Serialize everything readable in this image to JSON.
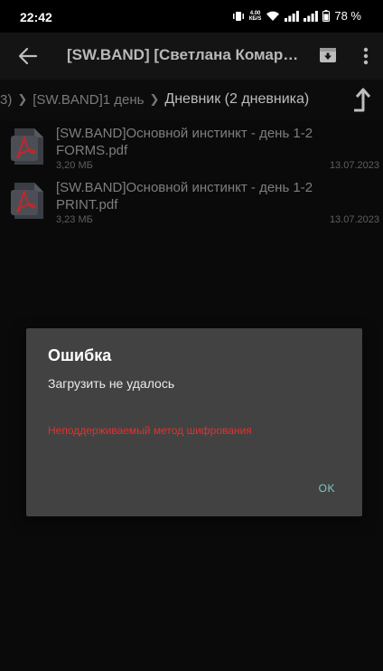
{
  "status_bar": {
    "time": "22:42",
    "net_speed_value": "4.00",
    "net_speed_unit": "КБ/S",
    "battery": "78 %"
  },
  "app_bar": {
    "title": "[SW.BAND] [Светлана Комаровская]"
  },
  "breadcrumb": {
    "items": [
      "3)",
      "[SW.BAND]1 день",
      "Дневник (2 дневника)"
    ]
  },
  "files": [
    {
      "name": "[SW.BAND]Основной инстинкт - день 1-2 FORMS.pdf",
      "size": "3,20 МБ",
      "date": "13.07.2023",
      "icon": "pdf-icon"
    },
    {
      "name": "[SW.BAND]Основной инстинкт - день 1-2 PRINT.pdf",
      "size": "3,23 МБ",
      "date": "13.07.2023",
      "icon": "pdf-icon"
    }
  ],
  "dialog": {
    "title": "Ошибка",
    "message": "Загрузить не удалось",
    "error": "Неподдерживаемый метод шифрования",
    "ok_label": "OK"
  },
  "colors": {
    "dialog_bg": "#424242",
    "error_text": "#e0322d",
    "ok_button": "#7fc8c3",
    "pdf_red": "#c0272d"
  }
}
